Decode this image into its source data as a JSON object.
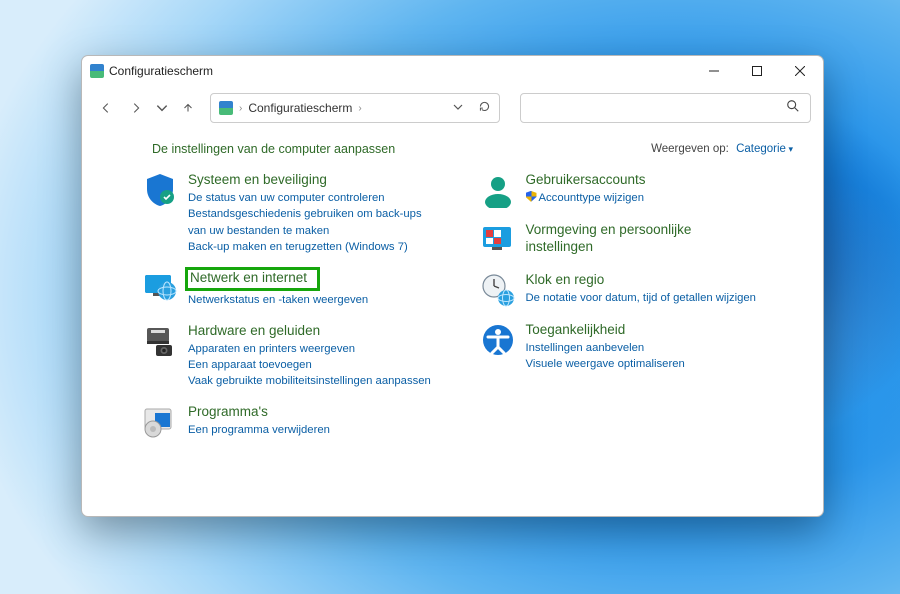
{
  "window": {
    "title": "Configuratiescherm"
  },
  "breadcrumb": {
    "root": "Configuratiescherm"
  },
  "content": {
    "title": "De instellingen van de computer aanpassen",
    "view_by_label": "Weergeven op:",
    "view_by_value": "Categorie"
  },
  "categories": {
    "system": {
      "title": "Systeem en beveiliging",
      "links": [
        "De status van uw computer controleren",
        "Bestandsgeschiedenis gebruiken om back-ups van uw bestanden te maken",
        "Back-up maken en terugzetten (Windows 7)"
      ]
    },
    "network": {
      "title": "Netwerk en internet",
      "links": [
        "Netwerkstatus en -taken weergeven"
      ]
    },
    "hardware": {
      "title": "Hardware en geluiden",
      "links": [
        "Apparaten en printers weergeven",
        "Een apparaat toevoegen",
        "Vaak gebruikte mobiliteitsinstellingen aanpassen"
      ]
    },
    "programs": {
      "title": "Programma's",
      "links": [
        "Een programma verwijderen"
      ]
    },
    "users": {
      "title": "Gebruikersaccounts",
      "links": [
        "Accounttype wijzigen"
      ]
    },
    "personalization": {
      "title": "Vormgeving en persoonlijke instellingen",
      "links": []
    },
    "clock": {
      "title": "Klok en regio",
      "links": [
        "De notatie voor datum, tijd of getallen wijzigen"
      ]
    },
    "accessibility": {
      "title": "Toegankelijkheid",
      "links": [
        "Instellingen aanbevelen",
        "Visuele weergave optimaliseren"
      ]
    }
  }
}
